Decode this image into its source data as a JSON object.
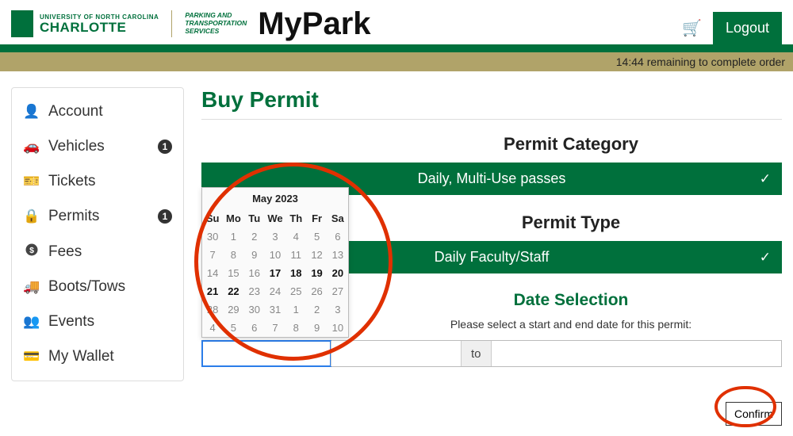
{
  "logo": {
    "univ": "UNIVERSITY OF NORTH CAROLINA",
    "name": "CHARLOTTE",
    "dept1": "PARKING AND",
    "dept2": "TRANSPORTATION",
    "dept3": "SERVICES"
  },
  "app_title": "MyPark",
  "logout": "Logout",
  "timer": "14:44 remaining to complete order",
  "sidebar": {
    "items": [
      {
        "label": "Account"
      },
      {
        "label": "Vehicles",
        "badge": "1"
      },
      {
        "label": "Tickets"
      },
      {
        "label": "Permits",
        "badge": "1"
      },
      {
        "label": "Fees"
      },
      {
        "label": "Boots/Tows"
      },
      {
        "label": "Events"
      },
      {
        "label": "My Wallet"
      }
    ]
  },
  "main": {
    "page_title": "Buy Permit",
    "cat_title": "Permit Category",
    "cat_value": "Daily, Multi-Use passes",
    "type_title": "Permit Type",
    "type_value": "Daily Faculty/Staff",
    "date_title": "Date Selection",
    "date_help": "Please select a start and end date for this permit:",
    "to": "to",
    "confirm": "Confirm"
  },
  "calendar": {
    "month": "May 2023",
    "dow": [
      "Su",
      "Mo",
      "Tu",
      "We",
      "Th",
      "Fr",
      "Sa"
    ],
    "weeks": [
      [
        {
          "d": "30"
        },
        {
          "d": "1"
        },
        {
          "d": "2"
        },
        {
          "d": "3"
        },
        {
          "d": "4"
        },
        {
          "d": "5"
        },
        {
          "d": "6"
        }
      ],
      [
        {
          "d": "7"
        },
        {
          "d": "8"
        },
        {
          "d": "9"
        },
        {
          "d": "10"
        },
        {
          "d": "11"
        },
        {
          "d": "12"
        },
        {
          "d": "13"
        }
      ],
      [
        {
          "d": "14"
        },
        {
          "d": "15"
        },
        {
          "d": "16"
        },
        {
          "d": "17",
          "avail": true
        },
        {
          "d": "18",
          "avail": true
        },
        {
          "d": "19",
          "avail": true
        },
        {
          "d": "20",
          "avail": true
        }
      ],
      [
        {
          "d": "21",
          "avail": true
        },
        {
          "d": "22",
          "avail": true
        },
        {
          "d": "23"
        },
        {
          "d": "24"
        },
        {
          "d": "25"
        },
        {
          "d": "26"
        },
        {
          "d": "27"
        }
      ],
      [
        {
          "d": "28"
        },
        {
          "d": "29"
        },
        {
          "d": "30"
        },
        {
          "d": "31"
        },
        {
          "d": "1"
        },
        {
          "d": "2"
        },
        {
          "d": "3"
        }
      ],
      [
        {
          "d": "4"
        },
        {
          "d": "5"
        },
        {
          "d": "6"
        },
        {
          "d": "7"
        },
        {
          "d": "8"
        },
        {
          "d": "9"
        },
        {
          "d": "10"
        }
      ]
    ]
  }
}
